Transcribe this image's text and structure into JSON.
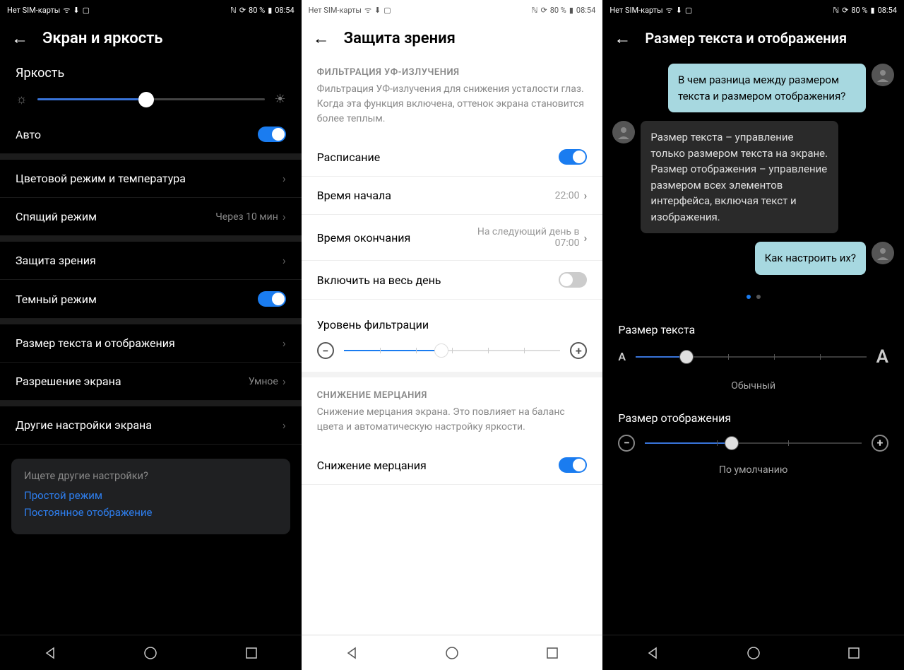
{
  "statusbar": {
    "left": "Нет SIM-карты",
    "battery": "80 %",
    "time": "08:54"
  },
  "screen1": {
    "title": "Экран и яркость",
    "brightness_label": "Яркость",
    "auto_label": "Авто",
    "items": {
      "color": "Цветовой режим и температура",
      "sleep": "Спящий режим",
      "sleep_val": "Через 10 мин",
      "eye": "Защита зрения",
      "dark": "Темный режим",
      "textsize": "Размер текста и отображения",
      "resolution": "Разрешение экрана",
      "resolution_val": "Умное",
      "other": "Другие настройки экрана"
    },
    "infobox": {
      "q": "Ищете другие настройки?",
      "l1": "Простой режим",
      "l2": "Постоянное отображение"
    }
  },
  "screen2": {
    "title": "Защита зрения",
    "section1": "ФИЛЬТРАЦИЯ УФ-ИЗЛУЧЕНИЯ",
    "desc1": "Фильтрация УФ-излучения для снижения усталости глаз. Когда эта функция включена, оттенок экрана становится более теплым.",
    "schedule": "Расписание",
    "start": "Время начала",
    "start_val": "22:00",
    "end": "Время окончания",
    "end_val": "На следующий день в 07:00",
    "allday": "Включить на весь день",
    "filter_level": "Уровень фильтрации",
    "section2": "СНИЖЕНИЕ МЕРЦАНИЯ",
    "desc2": "Снижение мерцания экрана. Это повлияет на баланс цвета и автоматическую настройку яркости.",
    "flicker": "Снижение мерцания"
  },
  "screen3": {
    "title": "Размер текста и отображения",
    "msg1": "В чем разница между размером текста и размером отображения?",
    "msg2": "Размер текста – управление только размером текста на экране. Размер отображения – управление размером всех элементов интерфейса, включая текст и изображения.",
    "msg3": "Как настроить их?",
    "text_size_label": "Размер текста",
    "text_size_val": "Обычный",
    "display_size_label": "Размер отображения",
    "display_size_val": "По умолчанию"
  }
}
